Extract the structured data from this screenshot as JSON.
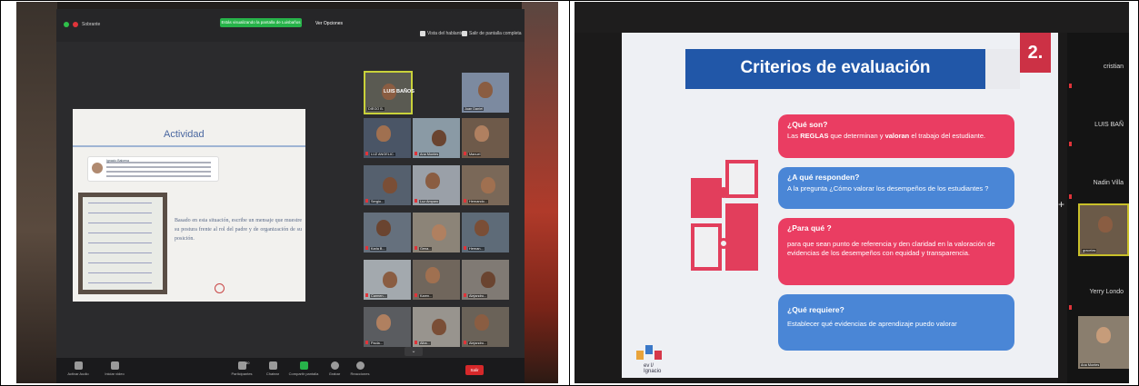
{
  "left_photo": {
    "window_title": "Sobrante",
    "share_banner": "Estás visualizando la pantalla de Luisbaños",
    "view_options": "Ver Opciones",
    "right_top_1": "Vista del hablante",
    "right_top_2": "Salir de pantalla completa",
    "slide": {
      "title": "Actividad",
      "tweet_user": "Ignacio Balcena",
      "body": "Basado en esta situación, escribe un mensaje que muestre su postura frente al rol del padre y de organización de su posición."
    },
    "active_speaker": "LUIS BAÑOS",
    "participants": [
      "DIEGO B.",
      "Juan Daniel",
      "LUZ ANGELIC.",
      "Ana Montes",
      "Manuel",
      "Sergio...",
      "Luz Amparo",
      "Hernando...",
      "Karla B...",
      "Gena...",
      "Hernan...",
      "Carmen...",
      "Karen...",
      "Alejandro...",
      "Paola...",
      "Alba...",
      "Alejandro...",
      "Luz María...",
      "Laura..."
    ],
    "toolbar": {
      "audio": "Activar Audio",
      "video": "Iniciar video",
      "participants": "Participantes",
      "participants_count": "30",
      "chat": "Chatear",
      "share": "Compartir pantalla",
      "record": "Grabar",
      "reactions": "Reacciones",
      "leave": "Salir"
    }
  },
  "right_photo": {
    "slide_title": "Criterios de evaluación",
    "slide_number": "2.",
    "cards": [
      {
        "heading": "¿Qué son?",
        "body_parts": [
          "Las ",
          "REGLAS",
          " que determinan y ",
          "valoran",
          " el trabajo del estudiante."
        ]
      },
      {
        "heading": "¿A qué responden?",
        "body": "A la pregunta ¿Cómo valorar los desempeños de los estudiantes ?"
      },
      {
        "heading": "¿Para qué ?",
        "body": "para que sean punto de referencia y den claridad en la valoración de evidencias de los desempeños con equidad y transparencia."
      },
      {
        "heading": "¿Qué requiere?",
        "body": "Establecer qué evidencias de aprendizaje puedo valorar"
      }
    ],
    "logo_text": "ev l/ Ignacio",
    "side_names": [
      "cristian",
      "LUIS BAÑ",
      "Nadin Villa",
      "gracelas",
      "Yerry Londo",
      "Ana Montes"
    ]
  },
  "colors": {
    "title_blue": "#2157a8",
    "card_red": "#ea3d62",
    "card_blue": "#4a86d6",
    "zoom_green": "#27b34a",
    "leave_red": "#d6282a"
  }
}
